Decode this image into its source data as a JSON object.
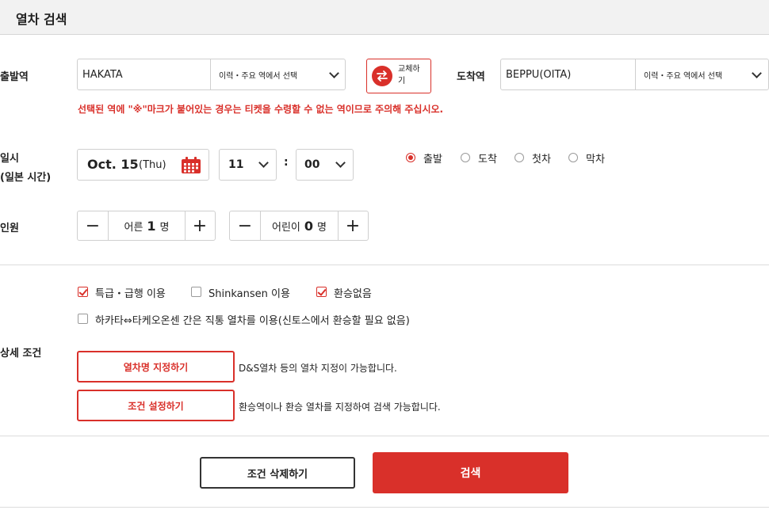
{
  "header": {
    "title": "열차 검색"
  },
  "departure": {
    "label": "출발역",
    "value": "HAKATA",
    "select_label": "이력・주요 역에서 선택"
  },
  "swap": {
    "label": "교체하기"
  },
  "arrival": {
    "label": "도착역",
    "value": "BEPPU(OITA)",
    "select_label": "이력・주요 역에서 선택"
  },
  "warning": "선택된 역에 \"※\"마크가 붙어있는 경우는 티켓을 수령할 수 없는 역이므로 주의해 주십시오.",
  "datetime": {
    "label_line1": "일시",
    "label_line2": "(일본 시간)",
    "date_main": "Oct. 15",
    "date_day": "(Thu)",
    "hour": "11",
    "separator": ":",
    "minute": "00",
    "options": [
      {
        "label": "출발",
        "selected": true
      },
      {
        "label": "도착",
        "selected": false
      },
      {
        "label": "첫차",
        "selected": false
      },
      {
        "label": "막차",
        "selected": false
      }
    ]
  },
  "passengers": {
    "label": "인원",
    "minus": "−",
    "plus": "+",
    "adult_label": "어른",
    "adult_count": "1",
    "child_label": "어린이",
    "child_count": "0",
    "unit": "명"
  },
  "details": {
    "label": "상세 조건",
    "checks": [
      {
        "label": "특급・급행 이용",
        "checked": true
      },
      {
        "label": "Shinkansen 이용",
        "checked": false
      },
      {
        "label": "환승없음",
        "checked": true
      },
      {
        "label": "하카타⇔타케오온센 간은 직통 열차를 이용(신토스에서 환승할 필요 없음)",
        "checked": false
      }
    ],
    "train_name_button": "열차명 지정하기",
    "train_name_desc": "D&S열차 등의 열차 지정이 가능합니다.",
    "condition_button": "조건 설정하기",
    "condition_desc": "환승역이나 환승 열차를 지정하여 검색 가능합니다."
  },
  "actions": {
    "clear": "조건 삭제하기",
    "search": "검색"
  },
  "colors": {
    "accent": "#d9302a",
    "header_bg": "#f2f2f2"
  }
}
